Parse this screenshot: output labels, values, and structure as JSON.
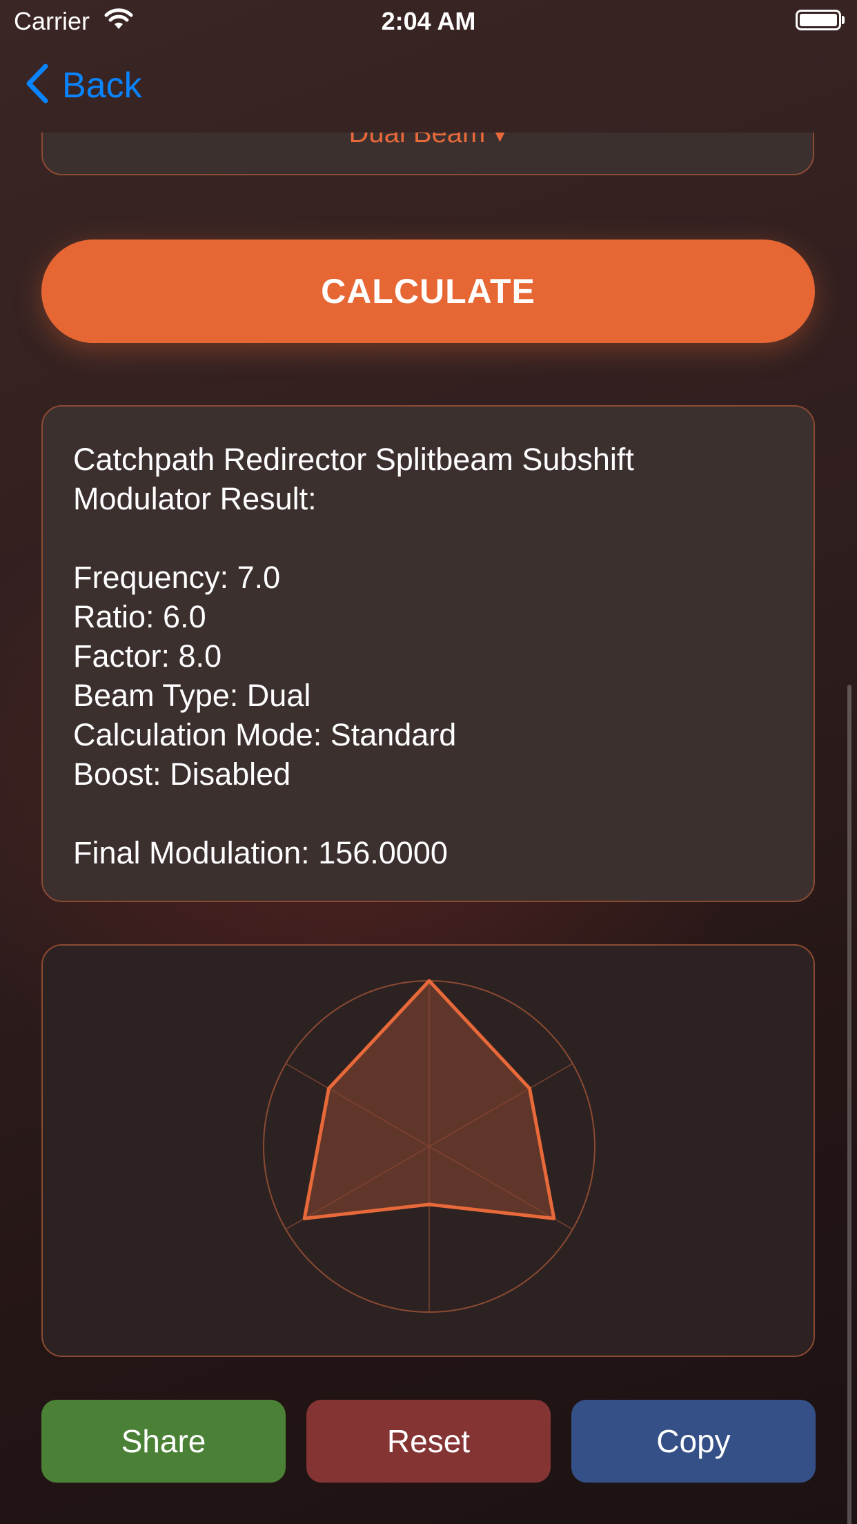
{
  "status_bar": {
    "carrier": "Carrier",
    "time": "2:04 AM"
  },
  "nav": {
    "back_label": "Back"
  },
  "picker": {
    "selected_value": "Dual Beam ▾"
  },
  "calculate_label": "CALCULATE",
  "result": {
    "heading_line1": "Catchpath Redirector Splitbeam Subshift",
    "heading_line2": "Modulator Result:",
    "frequency": "Frequency: 7.0",
    "ratio": "Ratio: 6.0",
    "factor": "Factor: 8.0",
    "beam_type": "Beam Type: Dual",
    "calculation_mode": "Calculation Mode: Standard",
    "boost": "Boost: Disabled",
    "final_modulation": "Final Modulation: 156.0000"
  },
  "chart_data": {
    "type": "radar",
    "axes": 6,
    "values": [
      1.0,
      0.7,
      0.87,
      0.35,
      0.87,
      0.7
    ],
    "max": 1.0,
    "colors": {
      "stroke": "#e8693a",
      "fill": "#6b3a2c",
      "grid": "#8b4a32"
    }
  },
  "actions": {
    "share_label": "Share",
    "reset_label": "Reset",
    "copy_label": "Copy"
  },
  "colors": {
    "accent": "#e66634",
    "link": "#0a84ff",
    "share": "#4a8136",
    "reset": "#843433",
    "copy": "#345086"
  }
}
